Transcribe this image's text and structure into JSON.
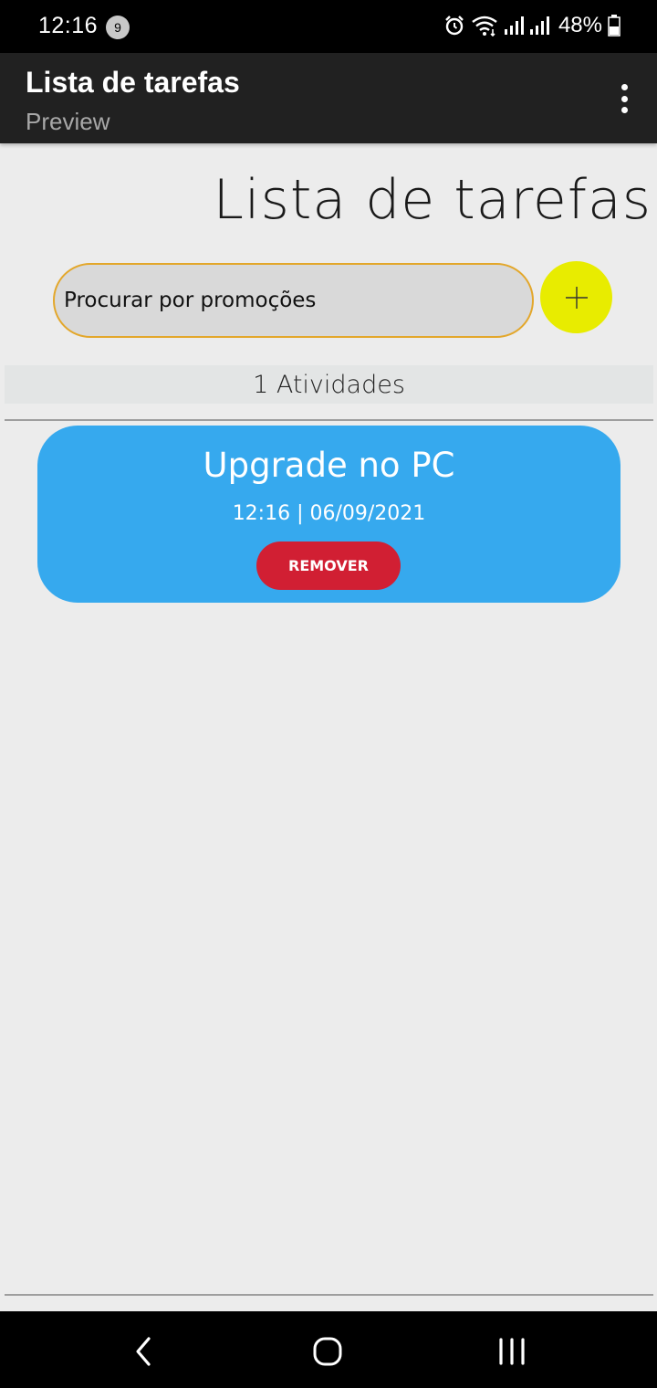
{
  "status_bar": {
    "time": "12:16",
    "notification_count": "9",
    "battery": "48%",
    "icons": [
      "alarm-icon",
      "wifi-icon",
      "signal-icon",
      "signal-icon",
      "battery-icon"
    ]
  },
  "app_bar": {
    "title": "Lista de tarefas",
    "subtitle": "Preview",
    "menu_icon": "more-vert-icon"
  },
  "main": {
    "heading": "Lista de tarefas",
    "search": {
      "placeholder": "Procurar por promoções",
      "value": ""
    },
    "add_button_icon": "plus-icon",
    "add_button_color": "#e8ec00",
    "activity_count": "1 Atividades",
    "tasks": [
      {
        "title": "Upgrade no PC",
        "datetime": "12:16 | 06/09/2021",
        "remove_label": "REMOVER",
        "card_color": "#36a9ee",
        "button_color": "#d11f33"
      }
    ]
  },
  "nav_bar": {
    "icons": [
      "back-icon",
      "home-icon",
      "recents-icon"
    ]
  }
}
